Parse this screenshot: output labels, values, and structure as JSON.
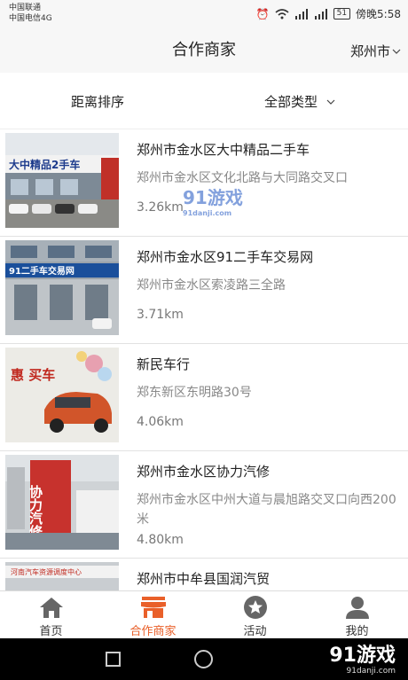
{
  "status_bar": {
    "carrier1": "中国联通",
    "carrier2": "中国电信4G",
    "battery": "51",
    "time": "傍晚5:58"
  },
  "header": {
    "title": "合作商家",
    "city": "郑州市"
  },
  "filters": {
    "sort_label": "距离排序",
    "type_label": "全部类型"
  },
  "items": [
    {
      "name": "郑州市金水区大中精品二手车",
      "address": "郑州市金水区文化北路与大同路交叉口",
      "distance": "3.26km",
      "sign": "大中精品2手车"
    },
    {
      "name": "郑州市金水区91二手车交易网",
      "address": "郑州市金水区索凌路三全路",
      "distance": "3.71km",
      "sign": "91二手车交易网"
    },
    {
      "name": "新民车行",
      "address": "郑东新区东明路30号",
      "distance": "4.06km",
      "sign": "惠 买车"
    },
    {
      "name": "郑州市金水区协力汽修",
      "address": "郑州市金水区中州大道与晨旭路交叉口向西200米",
      "distance": "4.80km",
      "sign": "协力汽修"
    },
    {
      "name": "郑州市中牟县国润汽贸",
      "address": "",
      "distance": "",
      "sign": "河南汽车资源调度中心"
    }
  ],
  "tabs": [
    {
      "label": "首页",
      "icon": "home-icon"
    },
    {
      "label": "合作商家",
      "icon": "shop-icon"
    },
    {
      "label": "活动",
      "icon": "star-icon"
    },
    {
      "label": "我的",
      "icon": "user-icon"
    }
  ],
  "watermark": {
    "brand": "91游戏",
    "site": "91danji.com",
    "mid_brand": "91游戏",
    "mid_site": "91danji.com"
  },
  "colors": {
    "accent": "#e9602a",
    "background": "#f7f7f7"
  }
}
